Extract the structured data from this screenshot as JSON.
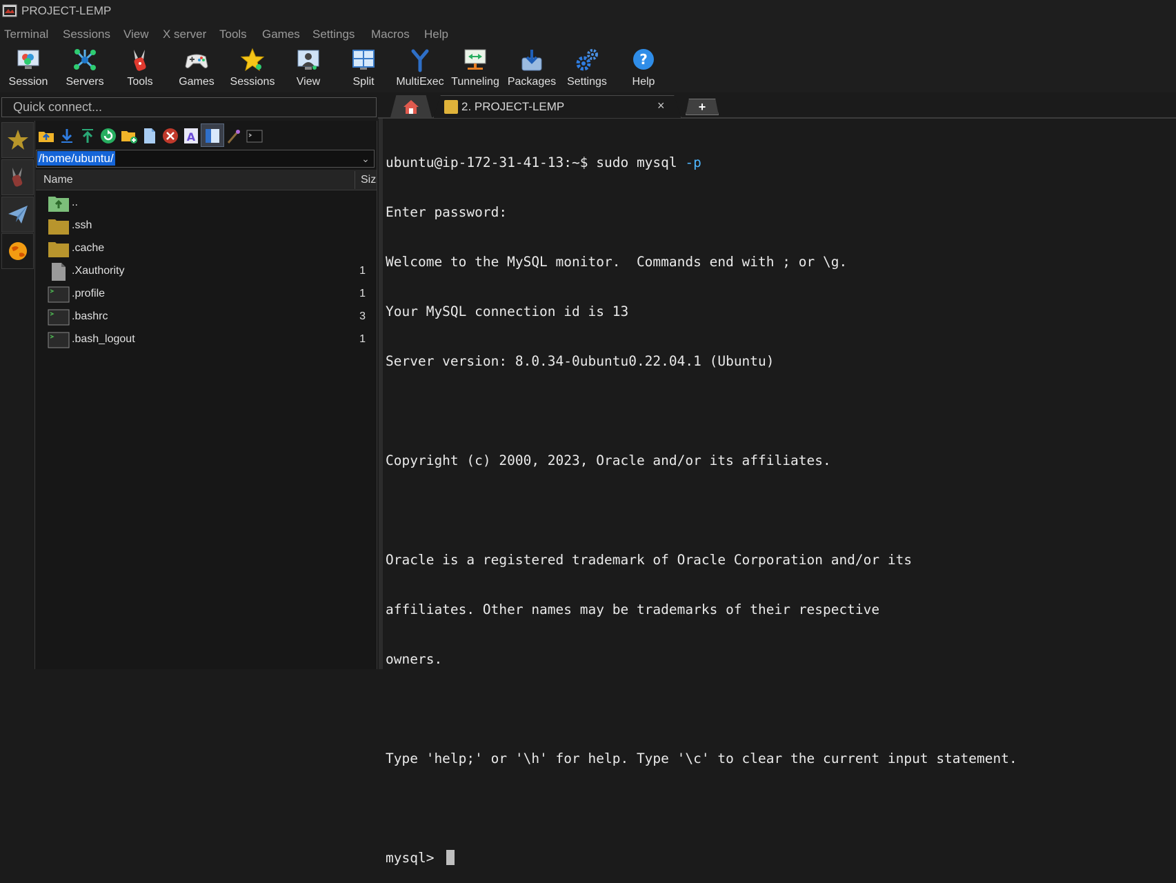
{
  "window": {
    "title": "PROJECT-LEMP"
  },
  "menu": [
    "Terminal",
    "Sessions",
    "View",
    "X server",
    "Tools",
    "Games",
    "Settings",
    "Macros",
    "Help"
  ],
  "toolbar": [
    {
      "label": "Session",
      "icon": "session-icon"
    },
    {
      "label": "Servers",
      "icon": "servers-icon"
    },
    {
      "label": "Tools",
      "icon": "tools-icon"
    },
    {
      "label": "Games",
      "icon": "gamepad-icon"
    },
    {
      "label": "Sessions",
      "icon": "star-icon"
    },
    {
      "label": "View",
      "icon": "view-icon"
    },
    {
      "label": "Split",
      "icon": "split-icon"
    },
    {
      "label": "MultiExec",
      "icon": "multiexec-icon"
    },
    {
      "label": "Tunneling",
      "icon": "tunneling-icon"
    },
    {
      "label": "Packages",
      "icon": "packages-icon"
    },
    {
      "label": "Settings",
      "icon": "gears-icon"
    },
    {
      "label": "Help",
      "icon": "help-icon"
    }
  ],
  "quick_connect": {
    "placeholder": "Quick connect..."
  },
  "tabs": {
    "session_label": "2. PROJECT-LEMP",
    "close_glyph": "×",
    "new_tab_glyph": "+"
  },
  "sftp": {
    "path": "/home/ubuntu/",
    "columns": {
      "name": "Name",
      "size": "Size"
    },
    "files": [
      {
        "name": "..",
        "size": "",
        "icon": "parent-folder-icon"
      },
      {
        "name": ".ssh",
        "size": "",
        "icon": "folder-icon"
      },
      {
        "name": ".cache",
        "size": "",
        "icon": "folder-icon"
      },
      {
        "name": ".Xauthority",
        "size": "1",
        "icon": "file-icon"
      },
      {
        "name": ".profile",
        "size": "1",
        "icon": "terminal-file-icon"
      },
      {
        "name": ".bashrc",
        "size": "3",
        "icon": "terminal-file-icon"
      },
      {
        "name": ".bash_logout",
        "size": "1",
        "icon": "terminal-file-icon"
      }
    ]
  },
  "terminal": {
    "prompt_line": "ubuntu@ip-172-31-41-13:~$ sudo mysql ",
    "prompt_option": "-p",
    "lines": [
      "Enter password:",
      "Welcome to the MySQL monitor.  Commands end with ; or \\g.",
      "Your MySQL connection id is 13",
      "Server version: 8.0.34-0ubuntu0.22.04.1 (Ubuntu)",
      "",
      "Copyright (c) 2000, 2023, Oracle and/or its affiliates.",
      "",
      "Oracle is a registered trademark of Oracle Corporation and/or its",
      "affiliates. Other names may be trademarks of their respective",
      "owners.",
      "",
      "Type 'help;' or '\\h' for help. Type '\\c' to clear the current input statement.",
      ""
    ],
    "mysql_prompt": "mysql> "
  }
}
